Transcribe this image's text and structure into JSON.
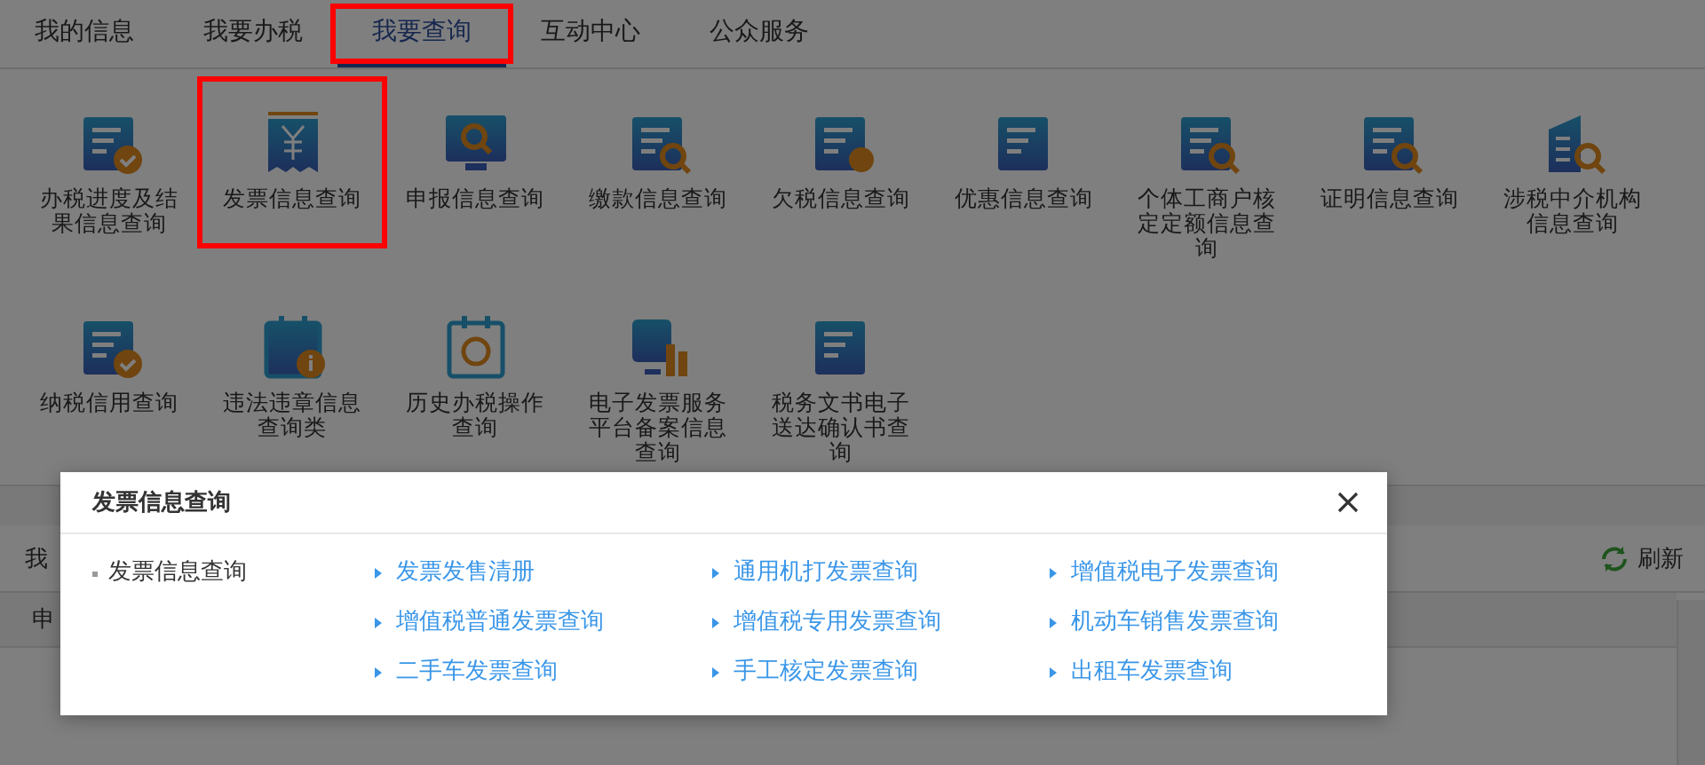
{
  "tabs": [
    {
      "label": "我的信息",
      "selected": false,
      "highlighted": false
    },
    {
      "label": "我要办税",
      "selected": false,
      "highlighted": false
    },
    {
      "label": "我要查询",
      "selected": true,
      "highlighted": true
    },
    {
      "label": "互动中心",
      "selected": false,
      "highlighted": false
    },
    {
      "label": "公众服务",
      "selected": false,
      "highlighted": false
    }
  ],
  "query_items": [
    {
      "label": "办税进度及结果信息查询",
      "highlighted": false
    },
    {
      "label": "发票信息查询",
      "highlighted": true
    },
    {
      "label": "申报信息查询",
      "highlighted": false
    },
    {
      "label": "缴款信息查询",
      "highlighted": false
    },
    {
      "label": "欠税信息查询",
      "highlighted": false
    },
    {
      "label": "优惠信息查询",
      "highlighted": false
    },
    {
      "label": "个体工商户核定定额信息查询",
      "highlighted": false
    },
    {
      "label": "证明信息查询",
      "highlighted": false
    },
    {
      "label": "涉税中介机构信息查询",
      "highlighted": false
    },
    {
      "label": "纳税信用查询",
      "highlighted": false
    },
    {
      "label": "违法违章信息查询类",
      "highlighted": false
    },
    {
      "label": "历史办税操作查询",
      "highlighted": false
    },
    {
      "label": "电子发票服务平台备案信息查询",
      "highlighted": false
    },
    {
      "label": "税务文书电子送达确认书查询",
      "highlighted": false
    }
  ],
  "background_panel": {
    "title": "我",
    "refresh": "刷新",
    "table_header": "申"
  },
  "modal": {
    "title": "发票信息查询",
    "category": "发票信息查询",
    "links": [
      "发票发售清册",
      "通用机打发票查询",
      "增值税电子发票查询",
      "增值税普通发票查询",
      "增值税专用发票查询",
      "机动车销售发票查询",
      "二手车发票查询",
      "手工核定发票查询",
      "出租车发票查询"
    ]
  }
}
